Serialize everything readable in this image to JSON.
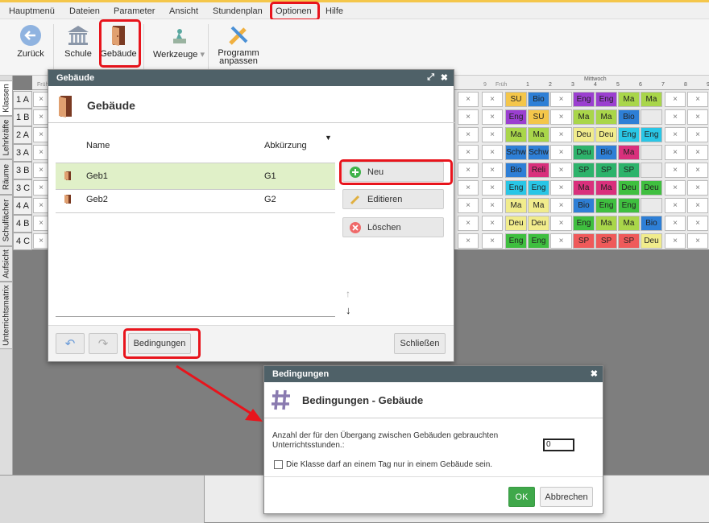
{
  "menu": [
    "Hauptmenü",
    "Dateien",
    "Parameter",
    "Ansicht",
    "Stundenplan",
    "Optionen",
    "Hilfe"
  ],
  "toolbar": {
    "back": "Zurück",
    "school": "Schule",
    "building": "Gebäude",
    "tools": "Werkzeuge",
    "customize_line1": "Programm",
    "customize_line2": "anpassen"
  },
  "side_tabs": [
    "Klassen",
    "Lehrkräfte",
    "Räume",
    "Schulfächer",
    "Aufsicht",
    "Unterrichtsmatrix"
  ],
  "grid": {
    "day_label": "Mittwoch",
    "frueh": "Früh",
    "frueh_left": "Früh",
    "period_left": "1",
    "period_9": "9",
    "periods": [
      "1",
      "2",
      "3",
      "4",
      "5",
      "6",
      "7",
      "8",
      "9"
    ],
    "rows": [
      "1 A",
      "1 B",
      "2 A",
      "3 A",
      "3 B",
      "3 C",
      "4 A",
      "4 B",
      "4 C"
    ],
    "cells": [
      [
        [
          "SU",
          "#f4c64a"
        ],
        [
          "Bio",
          "#2e7fd6"
        ],
        [
          "",
          ""
        ],
        [
          "Eng",
          "#9b3fd0"
        ],
        [
          "Eng",
          "#9b3fd0"
        ],
        [
          "Ma",
          "#a9d64a"
        ],
        [
          "Ma",
          "#a9d64a"
        ]
      ],
      [
        [
          "Eng",
          "#9b3fd0"
        ],
        [
          "SU",
          "#f4c64a"
        ],
        [
          "",
          ""
        ],
        [
          "Ma",
          "#a9d64a"
        ],
        [
          "Ma",
          "#a9d64a"
        ],
        [
          "Bio",
          "#2e7fd6"
        ],
        [
          "",
          ""
        ]
      ],
      [
        [
          "Ma",
          "#a9d64a"
        ],
        [
          "Ma",
          "#a9d64a"
        ],
        [
          "",
          ""
        ],
        [
          "Deu",
          "#f1ec8c"
        ],
        [
          "Deu",
          "#f1ec8c"
        ],
        [
          "Eng",
          "#29c6e6"
        ],
        [
          "Eng",
          "#29c6e6"
        ]
      ],
      [
        [
          "Schw",
          "#2e7fd6"
        ],
        [
          "Schw",
          "#2e7fd6"
        ],
        [
          "",
          ""
        ],
        [
          "Deu",
          "#2db36b"
        ],
        [
          "Bio",
          "#2e7fd6"
        ],
        [
          "Ma",
          "#d9307c"
        ],
        [
          "",
          ""
        ]
      ],
      [
        [
          "Bio",
          "#2e7fd6"
        ],
        [
          "Reli",
          "#d9307c"
        ],
        [
          "",
          ""
        ],
        [
          "SP",
          "#2db36b"
        ],
        [
          "SP",
          "#2db36b"
        ],
        [
          "SP",
          "#2db36b"
        ],
        [
          "",
          ""
        ]
      ],
      [
        [
          "Eng",
          "#29c6e6"
        ],
        [
          "Eng",
          "#29c6e6"
        ],
        [
          "",
          ""
        ],
        [
          "Ma",
          "#d9307c"
        ],
        [
          "Ma",
          "#d9307c"
        ],
        [
          "Deu",
          "#3fbf3f"
        ],
        [
          "Deu",
          "#3fbf3f"
        ]
      ],
      [
        [
          "Ma",
          "#f1ec8c"
        ],
        [
          "Ma",
          "#f1ec8c"
        ],
        [
          "",
          ""
        ],
        [
          "Bio",
          "#2e7fd6"
        ],
        [
          "Eng",
          "#3fbf3f"
        ],
        [
          "Eng",
          "#3fbf3f"
        ],
        [
          "",
          ""
        ]
      ],
      [
        [
          "Deu",
          "#f1ec8c"
        ],
        [
          "Deu",
          "#f1ec8c"
        ],
        [
          "",
          ""
        ],
        [
          "Eng",
          "#3fbf3f"
        ],
        [
          "Ma",
          "#a9d64a"
        ],
        [
          "Ma",
          "#a9d64a"
        ],
        [
          "Bio",
          "#2e7fd6"
        ]
      ],
      [
        [
          "Eng",
          "#3fbf3f"
        ],
        [
          "Eng",
          "#3fbf3f"
        ],
        [
          "",
          ""
        ],
        [
          "SP",
          "#ef5a5a"
        ],
        [
          "SP",
          "#ef5a5a"
        ],
        [
          "SP",
          "#ef5a5a"
        ],
        [
          "Deu",
          "#f1ec8c"
        ]
      ]
    ]
  },
  "geb_dialog": {
    "title": "Gebäude",
    "header": "Gebäude",
    "col_name": "Name",
    "col_abbr": "Abkürzung",
    "rows": [
      {
        "name": "Geb1",
        "abbr": "G1"
      },
      {
        "name": "Geb2",
        "abbr": "G2"
      }
    ],
    "btn_new": "Neu",
    "btn_edit": "Editieren",
    "btn_delete": "Löschen",
    "btn_conditions": "Bedingungen",
    "btn_close": "Schließen",
    "move_up": "↑",
    "move_down": "↓"
  },
  "bed_dialog": {
    "title": "Bedingungen",
    "header": "Bedingungen - Gebäude",
    "label_line1": "Anzahl der für den Übergang zwischen Gebäuden gebrauchten",
    "label_line2": "Unterrichtsstunden.:",
    "value": "0",
    "checkbox_label": "Die Klasse darf an einem Tag nur in einem Gebäude sein.",
    "btn_ok": "OK",
    "btn_cancel": "Abbrechen"
  },
  "colors": {
    "dialog_title": "#4f6168",
    "highlight": "#e8141c",
    "ok": "#3fa84a"
  }
}
